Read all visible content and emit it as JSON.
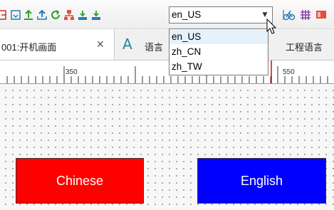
{
  "toolbar": {
    "language_select": {
      "value": "en_US"
    },
    "icons": [
      "select-frame-icon",
      "import-icon",
      "upload-icon",
      "export-icon",
      "refresh-icon",
      "network-icon",
      "download-a-icon",
      "download-b-icon",
      "ruler-icon",
      "bike-icon",
      "grid-icon",
      "screen-icon"
    ]
  },
  "tabs": [
    {
      "label": "001:开机画面",
      "active": true,
      "closable": true
    },
    {
      "label": "语言",
      "icon": "A"
    },
    {
      "label": "工程语言"
    }
  ],
  "dropdown": {
    "options": [
      "en_US",
      "zh_CN",
      "zh_TW"
    ],
    "highlighted": "en_US"
  },
  "ruler": {
    "labels": [
      "350",
      "550"
    ]
  },
  "canvas": {
    "buttons": [
      {
        "label": "Chinese",
        "color": "#ff0000"
      },
      {
        "label": "English",
        "color": "#0000ff"
      }
    ]
  },
  "colors": {
    "accent": "#ff0000",
    "grid": "#8f8f8f"
  }
}
